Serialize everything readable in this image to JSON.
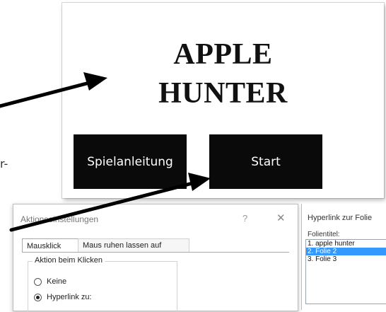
{
  "slide": {
    "title_line1": "APPLE",
    "title_line2": "HUNTER",
    "buttons": [
      "Spielanleitung",
      "Start"
    ]
  },
  "left_fragment": "r-",
  "dialog": {
    "title": "Aktionseinstellungen",
    "help_glyph": "?",
    "close_glyph": "✕",
    "tabs": [
      "Mausklick",
      "Maus ruhen lassen auf"
    ],
    "group_label": "Aktion beim Klicken",
    "options": [
      {
        "label": "Keine",
        "selected": false
      },
      {
        "label": "Hyperlink zu:",
        "selected": true
      }
    ]
  },
  "hyperlink_pane": {
    "title": "Hyperlink zur Folie",
    "label": "Folientitel:",
    "items": [
      "1. apple hunter",
      "2. Folie 2",
      "3. Folie 3"
    ],
    "selected_index": 1
  },
  "colors": {
    "slide_button_bg": "#0a0a0a",
    "selection": "#3399ff",
    "arrow": "#000000"
  }
}
